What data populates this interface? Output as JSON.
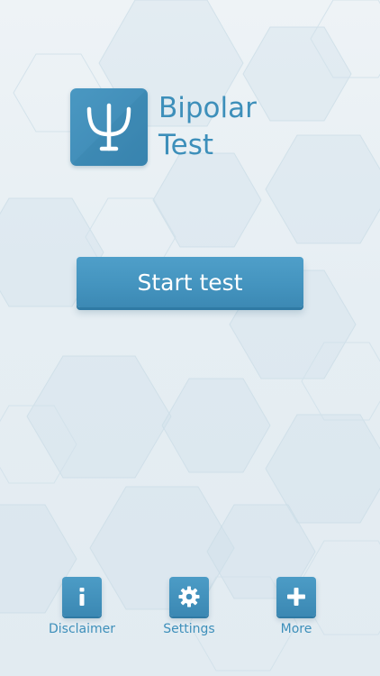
{
  "app": {
    "title_line1": "Bipolar",
    "title_line2": "Test",
    "logo_icon": "psi-icon"
  },
  "start_button": {
    "label": "Start test"
  },
  "bottom_nav": {
    "items": [
      {
        "label": "Disclaimer",
        "icon": "info-icon"
      },
      {
        "label": "Settings",
        "icon": "gear-icon"
      },
      {
        "label": "More",
        "icon": "plus-icon"
      }
    ]
  },
  "colors": {
    "accent": "#4494bf",
    "accent_text": "#3d8fba",
    "background": "#e6eef3"
  }
}
